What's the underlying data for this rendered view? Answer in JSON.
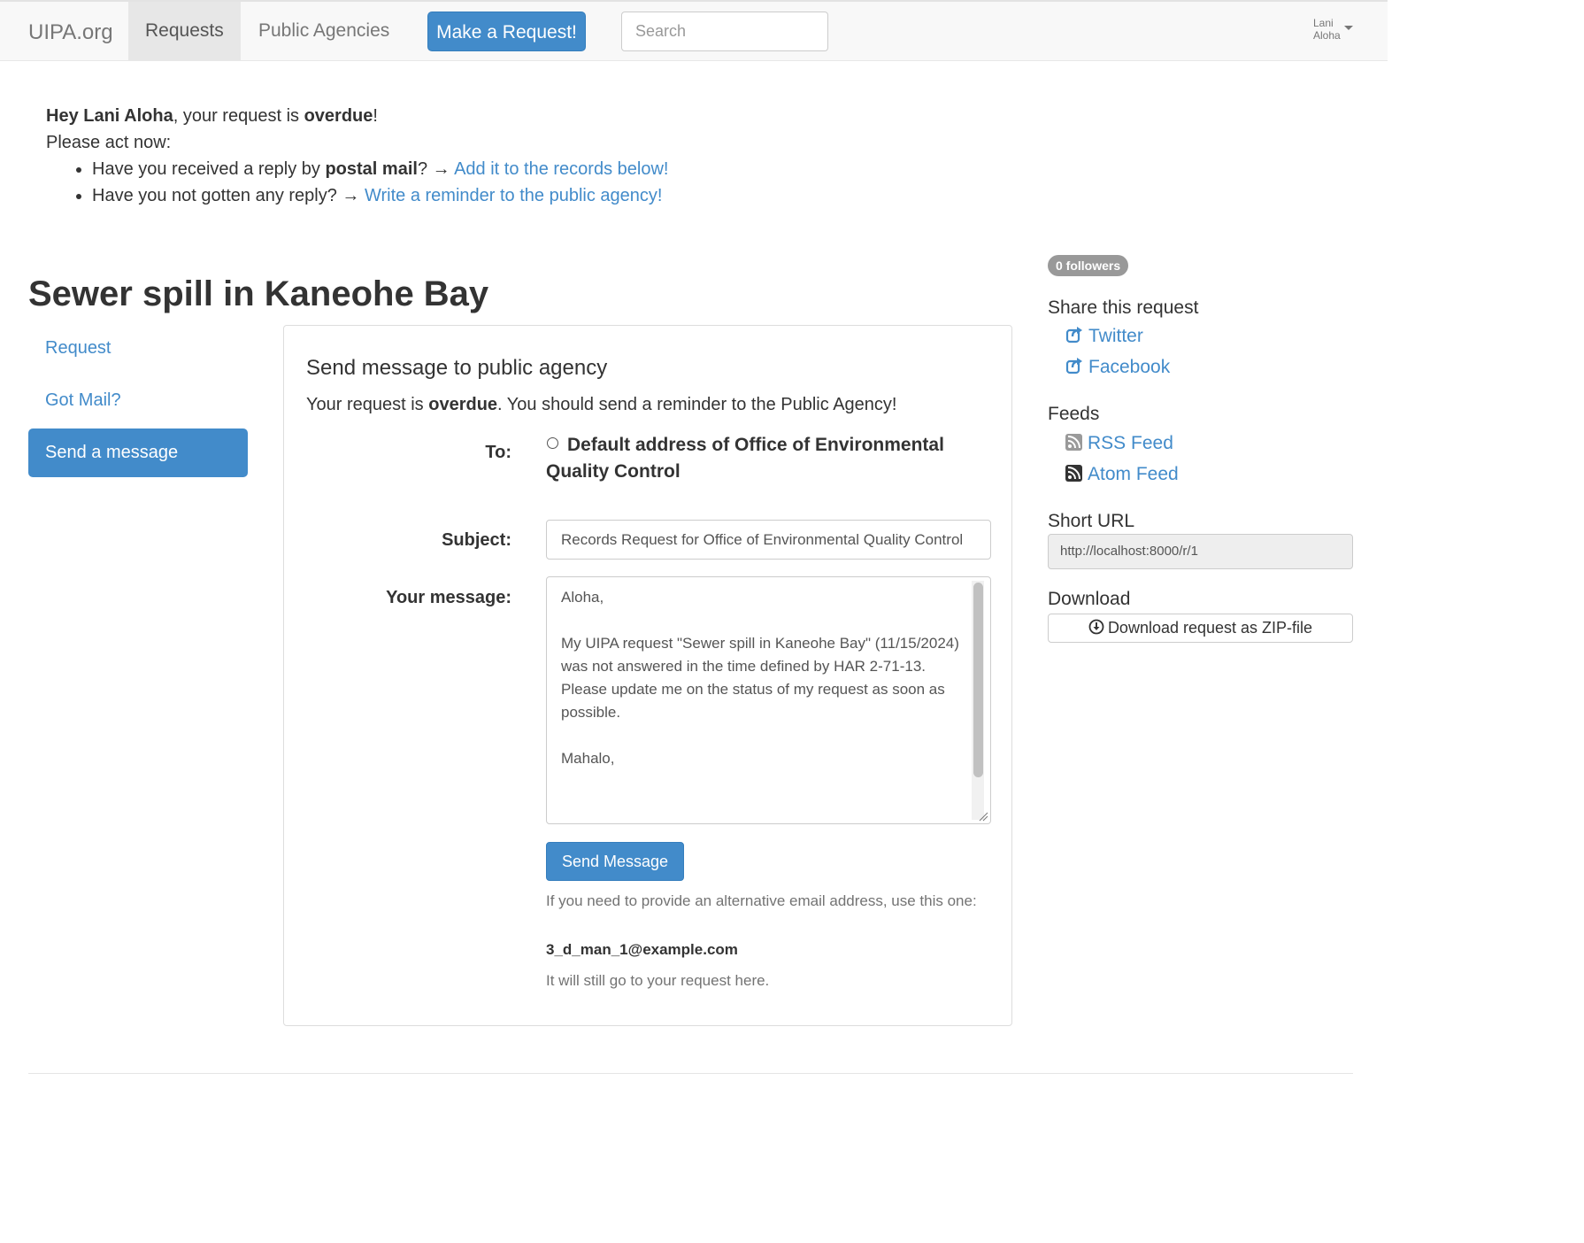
{
  "navbar": {
    "brand": "UIPA.org",
    "items": [
      {
        "label": "Requests"
      },
      {
        "label": "Public Agencies"
      }
    ],
    "cta": "Make a Request!",
    "search_placeholder": "Search",
    "user_first": "Lani",
    "user_last": "Aloha"
  },
  "alert": {
    "hey": "Hey ",
    "name": "Lani Aloha",
    "mid": ", your request is ",
    "status": "overdue",
    "end": "!",
    "act": "Please act now:",
    "item1_pre": "Have you received a reply by ",
    "item1_bold": "postal mail",
    "item1_post": "? → ",
    "item1_link": "Add it to the records below!",
    "item2_pre": "Have you not gotten any reply? → ",
    "item2_link": "Write a reminder to the public agency!"
  },
  "request_title": "Sewer spill in Kaneohe Bay",
  "sidebar": {
    "items": [
      {
        "label": "Request"
      },
      {
        "label": "Got Mail?"
      },
      {
        "label": "Send a message"
      }
    ]
  },
  "message_form": {
    "heading": "Send message to public agency",
    "overdue_pre": "Your request is ",
    "overdue_bold": "overdue",
    "overdue_post": ". You should send a reminder to the Public Agency!",
    "to_label": "To:",
    "to_value": "Default address of Office of Environmental Quality Control",
    "subject_label": "Subject:",
    "subject_value": "Records Request for Office of Environmental Quality Control",
    "message_label": "Your message:",
    "message_value": "Aloha,\n\nMy UIPA request \"Sewer spill in Kaneohe Bay\" (11/15/2024) was not answered in the time defined by HAR 2-71-13.\nPlease update me on the status of my request as soon as possible.\n\nMahalo,",
    "send_label": "Send Message",
    "help1": "If you need to provide an alternative email address, use this one:",
    "help_email": "3_d_man_1@example.com",
    "help2": "It will still go to your request here."
  },
  "right_sidebar": {
    "followers": "0 followers",
    "share_heading": "Share this request",
    "share_links": [
      {
        "label": "Twitter",
        "icon": "share-icon"
      },
      {
        "label": "Facebook",
        "icon": "share-icon"
      }
    ],
    "feeds_heading": "Feeds",
    "feed_links": [
      {
        "label": "RSS Feed",
        "icon": "rss-icon"
      },
      {
        "label": "Atom Feed",
        "icon": "rss-icon"
      }
    ],
    "short_url_heading": "Short URL",
    "short_url": "http://localhost:8000/r/1",
    "download_heading": "Download",
    "download_button": "Download request as ZIP-file"
  },
  "colors": {
    "link": "#428bca",
    "primary": "#428bca",
    "badge": "#999999"
  }
}
